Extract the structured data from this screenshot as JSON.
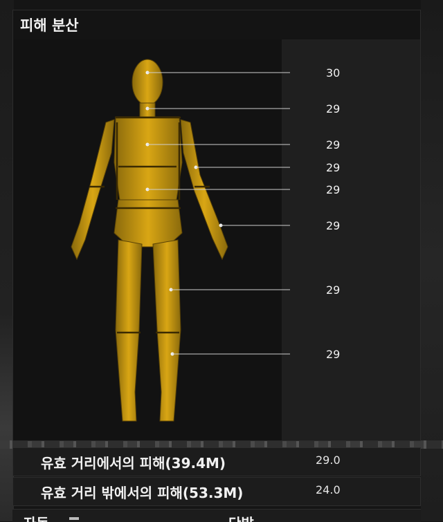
{
  "panel": {
    "title": "피해 분산",
    "body_parts": [
      {
        "part": "head",
        "value": "30"
      },
      {
        "part": "neck",
        "value": "29"
      },
      {
        "part": "chest",
        "value": "29"
      },
      {
        "part": "upper-arm",
        "value": "29"
      },
      {
        "part": "stomach",
        "value": "29"
      },
      {
        "part": "hand",
        "value": "29"
      },
      {
        "part": "thigh",
        "value": "29"
      },
      {
        "part": "shin",
        "value": "29"
      }
    ]
  },
  "stats": [
    {
      "label": "유효 거리에서의 피해(39.4M)",
      "value": "29.0"
    },
    {
      "label": "유효 거리 밖에서의 피해(53.3M)",
      "value": "24.0"
    }
  ],
  "bottom_row": {
    "left_label": "자동",
    "right_label": "단발"
  },
  "colors": {
    "skeleton": "#d9a614",
    "leader_line": "#cfcfcf",
    "background": "#151515"
  }
}
